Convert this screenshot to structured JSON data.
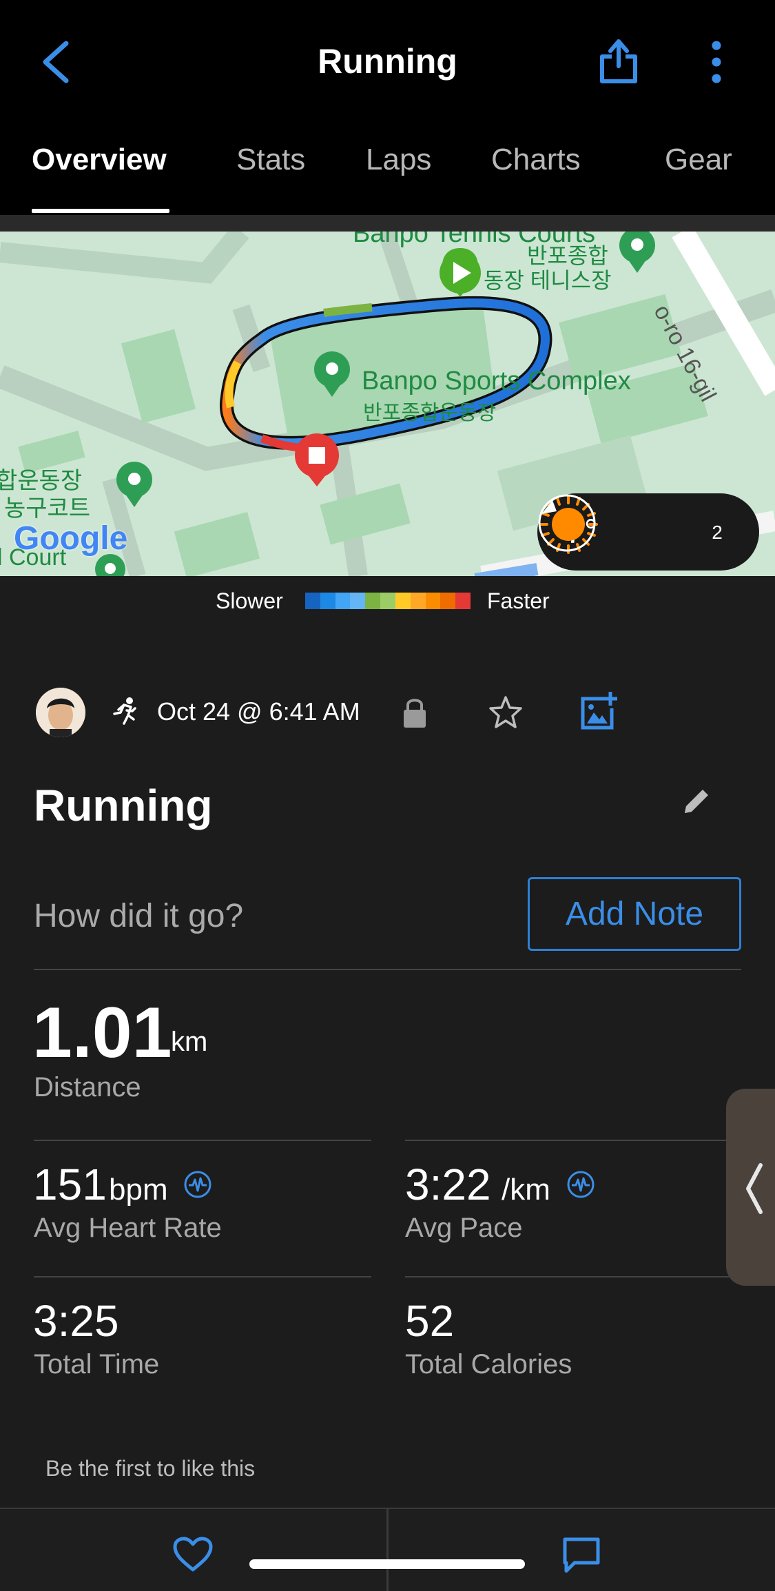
{
  "header": {
    "title": "Running",
    "back_icon": "chevron-left-icon",
    "share_icon": "share-icon",
    "more_icon": "more-vertical-icon",
    "accent_color": "#3b8ee8"
  },
  "tabs": [
    {
      "label": "Overview",
      "active": true
    },
    {
      "label": "Stats",
      "active": false
    },
    {
      "label": "Laps",
      "active": false
    },
    {
      "label": "Charts",
      "active": false
    },
    {
      "label": "Gear",
      "active": false
    }
  ],
  "map": {
    "labels": {
      "sports_complex_en": "Banpo Sports Complex",
      "sports_complex_ko": "반포종합운동장",
      "tennis_courts_en": "Banpo Tennis Courts",
      "tennis_courts_ko_1": "반포종합",
      "tennis_courts_ko_2": "동장 테니스장",
      "road": "o-ro 16-gil",
      "left_ko_1": "합운동장",
      "left_ko_2": "농구코트",
      "left_en": "l Court",
      "google": "Google"
    },
    "weather": {
      "temperature": "7°",
      "condition_icon": "sun-icon",
      "wind_speed": "2"
    }
  },
  "legend": {
    "slower": "Slower",
    "faster": "Faster",
    "colors": [
      "#1565c0",
      "#1e88e5",
      "#42a5f5",
      "#64b5f6",
      "#7cb342",
      "#9ccc65",
      "#ffca28",
      "#ffa726",
      "#fb8c00",
      "#ef6c00",
      "#e53935"
    ]
  },
  "activity": {
    "date": "Oct 24 @ 6:41 AM",
    "title": "Running",
    "note_prompt": "How did it go?",
    "add_note": "Add Note"
  },
  "stats": {
    "distance": {
      "value": "1.01",
      "unit": "km",
      "label": "Distance"
    },
    "heart_rate": {
      "value": "151",
      "unit": "bpm",
      "label": "Avg Heart Rate"
    },
    "pace": {
      "value": "3:22",
      "unit": "/km",
      "label": "Avg Pace"
    },
    "total_time": {
      "value": "3:25",
      "label": "Total Time"
    },
    "calories": {
      "value": "52",
      "label": "Total Calories"
    }
  },
  "social": {
    "likes_text": "Be the first to like this"
  }
}
